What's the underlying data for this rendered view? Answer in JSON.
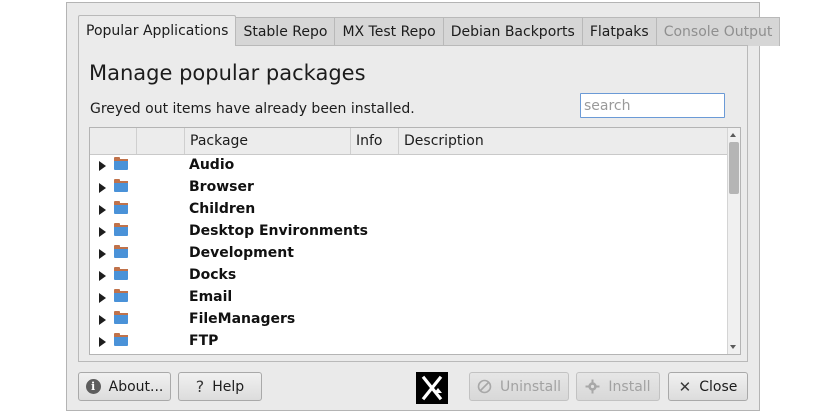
{
  "tabs": [
    {
      "label": "Popular Applications",
      "state": "active"
    },
    {
      "label": "Stable Repo",
      "state": "normal"
    },
    {
      "label": "MX Test Repo",
      "state": "normal"
    },
    {
      "label": "Debian Backports",
      "state": "normal"
    },
    {
      "label": "Flatpaks",
      "state": "normal"
    },
    {
      "label": "Console Output",
      "state": "disabled"
    }
  ],
  "main": {
    "title": "Manage popular packages",
    "subtitle": "Greyed out items have already been installed.",
    "search_placeholder": "search"
  },
  "tree": {
    "columns": [
      "Package",
      "Info",
      "Description"
    ],
    "rows": [
      "Audio",
      "Browser",
      "Children",
      "Desktop Environments",
      "Development",
      "Docks",
      "Email",
      "FileManagers",
      "FTP"
    ],
    "row_icon": "folder-icon",
    "expander_icon": "expand-arrow-icon"
  },
  "footer": {
    "about_label": "About...",
    "help_label": "Help",
    "uninstall_label": "Uninstall",
    "install_label": "Install",
    "close_label": "Close",
    "logo_icon": "mx-logo-icon"
  },
  "colors": {
    "window_bg": "#eaeaea",
    "folder": "#4a92d8",
    "search_border": "#6b9ad6",
    "disabled_text": "#a2a2a2"
  }
}
